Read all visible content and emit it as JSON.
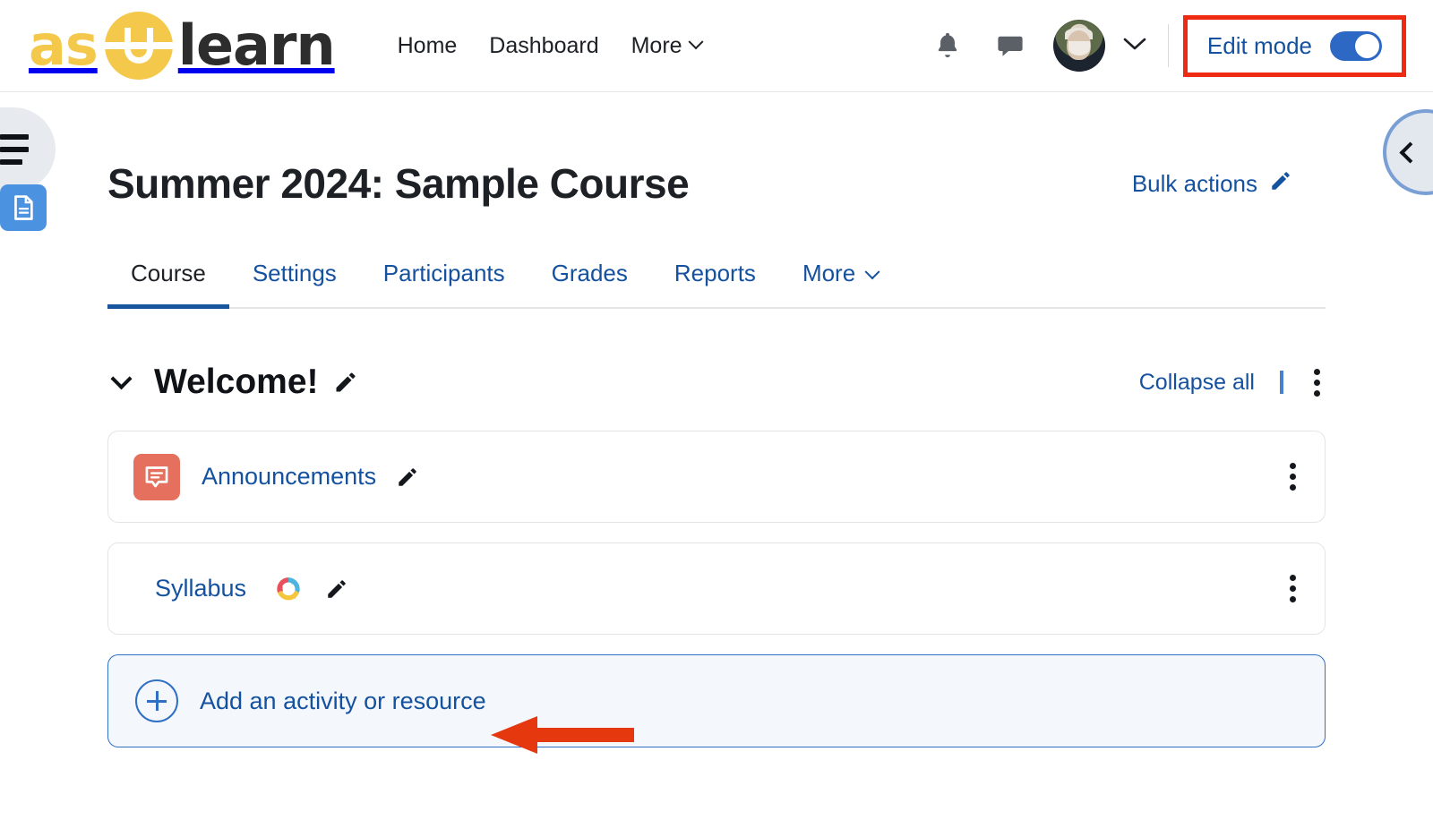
{
  "brand": {
    "text_left": "as",
    "text_right": "learn",
    "mark_icon": "appstate-u-logo-icon",
    "full_name": "asUlearn"
  },
  "navbar": {
    "links": [
      {
        "label": "Home",
        "icon": null
      },
      {
        "label": "Dashboard",
        "icon": null
      },
      {
        "label": "More",
        "icon": "chevron-down-icon"
      }
    ],
    "notifications_icon": "bell-icon",
    "messages_icon": "chat-bubble-icon",
    "avatar_icon": "user-avatar",
    "avatar_caret_icon": "chevron-down-icon",
    "edit_mode": {
      "label": "Edit mode",
      "state": "on",
      "highlight_color": "#ee2b12",
      "toggle_color": "#2d68c4"
    }
  },
  "drawers": {
    "left_toggle_icon": "course-index-list-icon",
    "right_toggle_icon": "chevron-left-icon"
  },
  "course": {
    "title": "Summer 2024: Sample Course",
    "bulk_actions": {
      "label": "Bulk actions",
      "icon": "pencil-icon"
    }
  },
  "tabs": [
    {
      "label": "Course",
      "active": true
    },
    {
      "label": "Settings",
      "active": false
    },
    {
      "label": "Participants",
      "active": false
    },
    {
      "label": "Grades",
      "active": false
    },
    {
      "label": "Reports",
      "active": false
    },
    {
      "label": "More",
      "active": false,
      "icon": "chevron-down-icon"
    }
  ],
  "section": {
    "toggle_icon": "chevron-down-icon",
    "title": "Welcome!",
    "edit_icon": "pencil-icon",
    "collapse_all": "Collapse all",
    "menu_icon": "kebab-menu-icon"
  },
  "activities": [
    {
      "name": "Announcements",
      "icon": "forum-icon",
      "icon_color": "#e4705d",
      "edit_icon": "pencil-icon",
      "badge": null,
      "menu_icon": "kebab-menu-icon"
    },
    {
      "name": "Syllabus",
      "icon": "page-document-icon",
      "icon_color": "#4b93e0",
      "edit_icon": "pencil-icon",
      "badge": "sync-circle-arrows-icon",
      "menu_icon": "kebab-menu-icon"
    }
  ],
  "add_activity": {
    "label": "Add an activity or resource",
    "icon": "plus-circle-icon",
    "callout_arrow": "red-left-arrow-annotation",
    "callout_color": "#e5380f"
  }
}
